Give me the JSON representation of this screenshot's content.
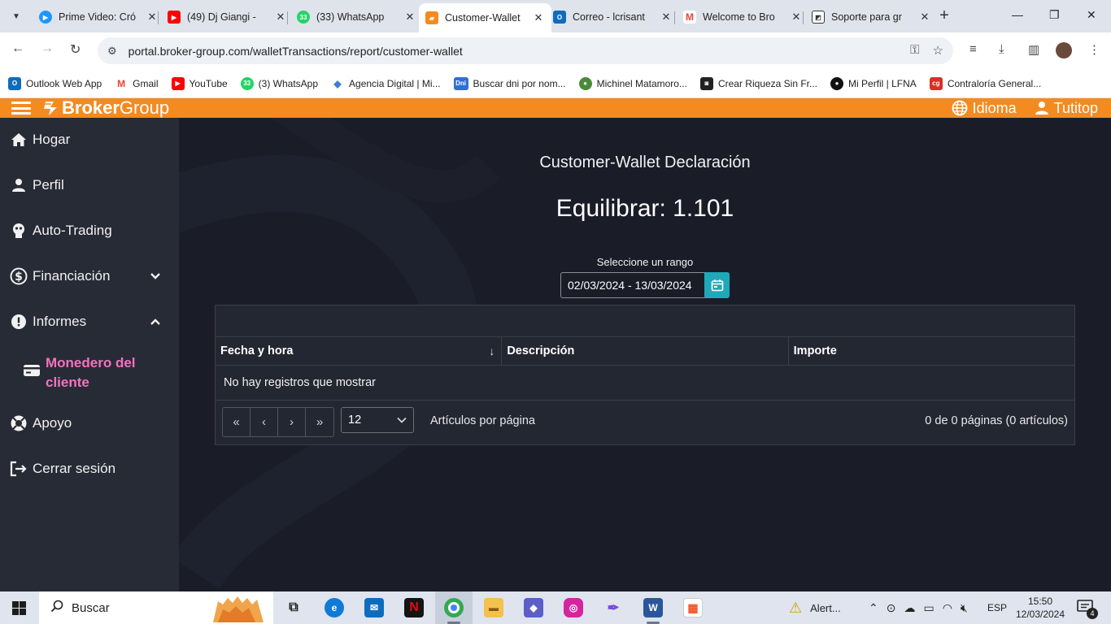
{
  "browser": {
    "tabs": [
      {
        "title": "Prime Video: Cró",
        "color": "#1a98ff"
      },
      {
        "title": "(49) Dj Giangi - ",
        "color": "#ff0000"
      },
      {
        "title": "(33) WhatsApp",
        "color": "#25d366"
      },
      {
        "title": "Customer-Wallet",
        "color": "#f58a1f"
      },
      {
        "title": "Correo - lcrisant",
        "color": "#0f6cbd"
      },
      {
        "title": "Welcome to Bro",
        "color": "#ea4335"
      },
      {
        "title": "Soporte para gr",
        "color": "#333333"
      }
    ],
    "url": "portal.broker-group.com/walletTransactions/report/customer-wallet",
    "bookmarks": [
      {
        "label": "Outlook Web App",
        "color": "#0f6cbd",
        "abbr": "O"
      },
      {
        "label": "Gmail",
        "color": "#ea4335",
        "abbr": "M"
      },
      {
        "label": "YouTube",
        "color": "#ff0000",
        "abbr": "▶"
      },
      {
        "label": "(3) WhatsApp",
        "color": "#25d366",
        "abbr": "33"
      },
      {
        "label": "Agencia Digital | Mi...",
        "color": "#3b7dd8",
        "abbr": "◆"
      },
      {
        "label": "Buscar dni por nom...",
        "color": "#2f6fd6",
        "abbr": "Dni"
      },
      {
        "label": "Michinel Matamoro...",
        "color": "#4a8a3a",
        "abbr": "●"
      },
      {
        "label": "Crear Riqueza Sin Fr...",
        "color": "#222222",
        "abbr": "◙"
      },
      {
        "label": "Mi Perfil | LFNA",
        "color": "#111111",
        "abbr": "●"
      },
      {
        "label": "Contraloría General...",
        "color": "#d93025",
        "abbr": "cg"
      }
    ]
  },
  "header": {
    "logo_bold": "Broker",
    "logo_light": "Group",
    "language": "Idioma",
    "user": "Tutitop",
    "accent": "#f58a1f"
  },
  "sidebar": {
    "items": [
      {
        "label": "Hogar",
        "icon": "home-icon"
      },
      {
        "label": "Perfil",
        "icon": "user-icon"
      },
      {
        "label": "Auto-Trading",
        "icon": "robot-icon"
      },
      {
        "label": "Financiación",
        "icon": "money-icon"
      },
      {
        "label": "Informes",
        "icon": "alert-icon"
      },
      {
        "label": "Apoyo",
        "icon": "support-icon"
      },
      {
        "label": "Cerrar sesión",
        "icon": "logout-icon"
      }
    ],
    "active_sub": "Monedero del cliente",
    "active_color": "#f472c0"
  },
  "main": {
    "title": "Customer-Wallet Declaración",
    "balance": "Equilibrar: 1.101",
    "range_label": "Seleccione un rango",
    "range_value": "02/03/2024 - 13/03/2024",
    "columns": [
      "Fecha y hora",
      "Descripción",
      "Importe"
    ],
    "sort_indicator": "↓",
    "empty_message": "No hay registros que mostrar",
    "page_size": "12",
    "per_page_label": "Artículos por página",
    "page_info": "0 de 0 páginas (0 artículos)"
  },
  "taskbar": {
    "search": "Buscar",
    "alert": "Alert...",
    "lang": "ESP",
    "time": "15:50",
    "date": "12/03/2024",
    "notifications": "4"
  }
}
